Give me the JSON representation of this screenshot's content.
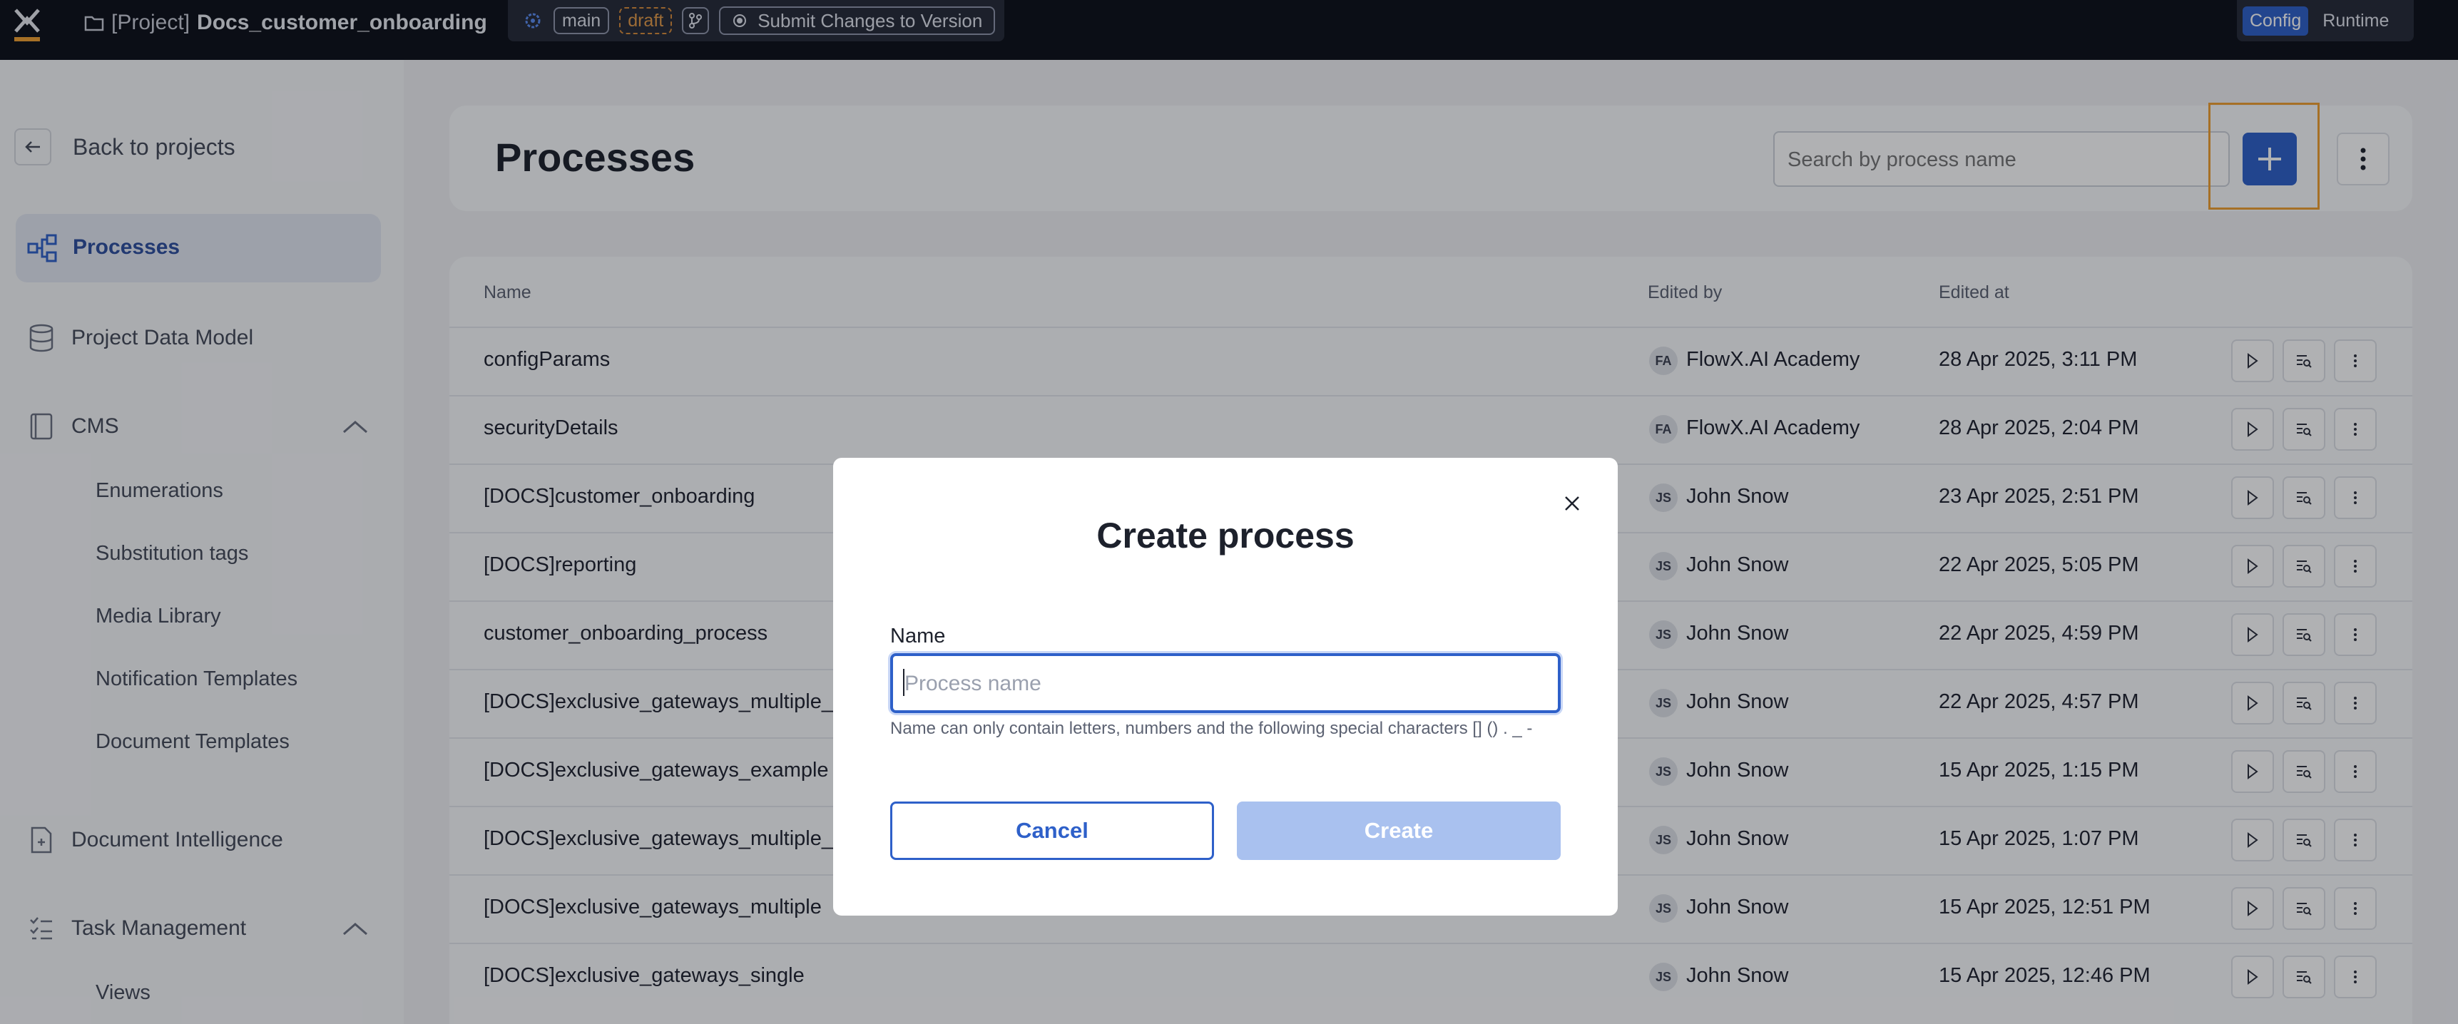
{
  "topbar": {
    "project_prefix": "[Project]",
    "project_name": "Docs_customer_onboarding",
    "branch": "main",
    "status": "draft",
    "submit_label": "Submit Changes to Version",
    "mode_config": "Config",
    "mode_runtime": "Runtime"
  },
  "sidebar": {
    "back_label": "Back to projects",
    "processes_label": "Processes",
    "data_model_label": "Project Data Model",
    "cms_label": "CMS",
    "cms_items": [
      "Enumerations",
      "Substitution tags",
      "Media Library",
      "Notification Templates",
      "Document Templates"
    ],
    "doc_intel_label": "Document Intelligence",
    "task_mgmt_label": "Task Management",
    "task_items": [
      "Views"
    ]
  },
  "main": {
    "title": "Processes",
    "search_placeholder": "Search by process name",
    "columns": {
      "name": "Name",
      "edited_by": "Edited by",
      "edited_at": "Edited at"
    },
    "rows": [
      {
        "name": "configParams",
        "initials": "FA",
        "editor": "FlowX.AI Academy",
        "date": "28 Apr 2025, 3:11 PM"
      },
      {
        "name": "securityDetails",
        "initials": "FA",
        "editor": "FlowX.AI Academy",
        "date": "28 Apr 2025, 2:04 PM"
      },
      {
        "name": "[DOCS]customer_onboarding",
        "initials": "JS",
        "editor": "John Snow",
        "date": "23 Apr 2025, 2:51 PM"
      },
      {
        "name": "[DOCS]reporting",
        "initials": "JS",
        "editor": "John Snow",
        "date": "22 Apr 2025, 5:05 PM"
      },
      {
        "name": "customer_onboarding_process",
        "initials": "JS",
        "editor": "John Snow",
        "date": "22 Apr 2025, 4:59 PM"
      },
      {
        "name": "[DOCS]exclusive_gateways_multiple_c",
        "initials": "JS",
        "editor": "John Snow",
        "date": "22 Apr 2025, 4:57 PM"
      },
      {
        "name": "[DOCS]exclusive_gateways_example",
        "initials": "JS",
        "editor": "John Snow",
        "date": "15 Apr 2025, 1:15 PM"
      },
      {
        "name": "[DOCS]exclusive_gateways_multiple_f",
        "initials": "JS",
        "editor": "John Snow",
        "date": "15 Apr 2025, 1:07 PM"
      },
      {
        "name": "[DOCS]exclusive_gateways_multiple",
        "initials": "JS",
        "editor": "John Snow",
        "date": "15 Apr 2025, 12:51 PM"
      },
      {
        "name": "[DOCS]exclusive_gateways_single",
        "initials": "JS",
        "editor": "John Snow",
        "date": "15 Apr 2025, 12:46 PM"
      }
    ]
  },
  "modal": {
    "title": "Create process",
    "field_label": "Name",
    "placeholder": "Process name",
    "hint": "Name can only contain letters, numbers and the following special characters [] () . _ -",
    "cancel_label": "Cancel",
    "create_label": "Create"
  },
  "colors": {
    "accent": "#2e60c9",
    "highlight": "#f0a030",
    "topbar_bg": "#0d0f18"
  }
}
